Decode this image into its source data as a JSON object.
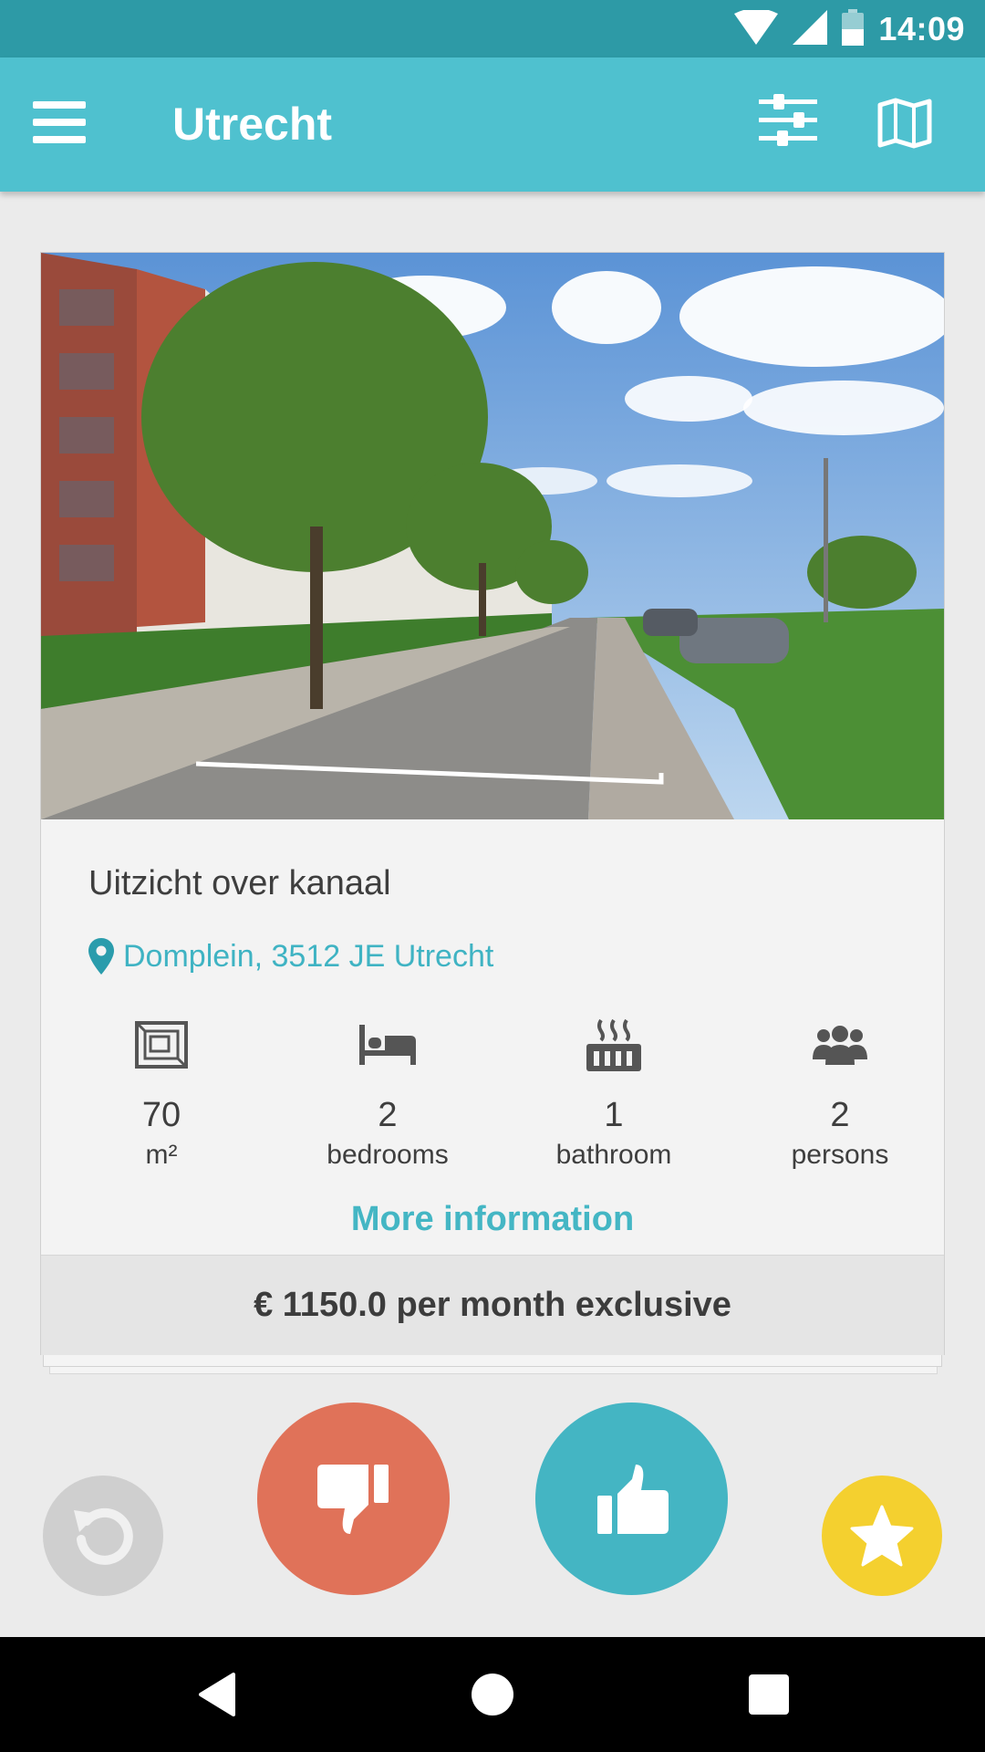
{
  "status_bar": {
    "time": "14:09"
  },
  "app_bar": {
    "title": "Utrecht"
  },
  "listing": {
    "title": "Uitzicht over kanaal",
    "address": "Domplein, 3512 JE Utrecht",
    "features": [
      {
        "icon": "floor-plan-icon",
        "value": "70",
        "unit": "m²"
      },
      {
        "icon": "bed-icon",
        "value": "2",
        "unit": "bedrooms"
      },
      {
        "icon": "bathtub-icon",
        "value": "1",
        "unit": "bathroom"
      },
      {
        "icon": "people-icon",
        "value": "2",
        "unit": "persons"
      }
    ],
    "more_info_label": "More information",
    "price": "€ 1150.0 per month exclusive"
  },
  "actions": {
    "undo": "undo-icon",
    "dislike": "thumbs-down-icon",
    "like": "thumbs-up-icon",
    "favorite": "star-icon"
  },
  "colors": {
    "status_bar": "#2d9aa6",
    "app_bar": "#4fc1cf",
    "accent": "#44b6c4",
    "dislike": "#e07259",
    "like": "#44b5c3",
    "favorite": "#f4d02f",
    "undo": "#cfcfcf"
  }
}
